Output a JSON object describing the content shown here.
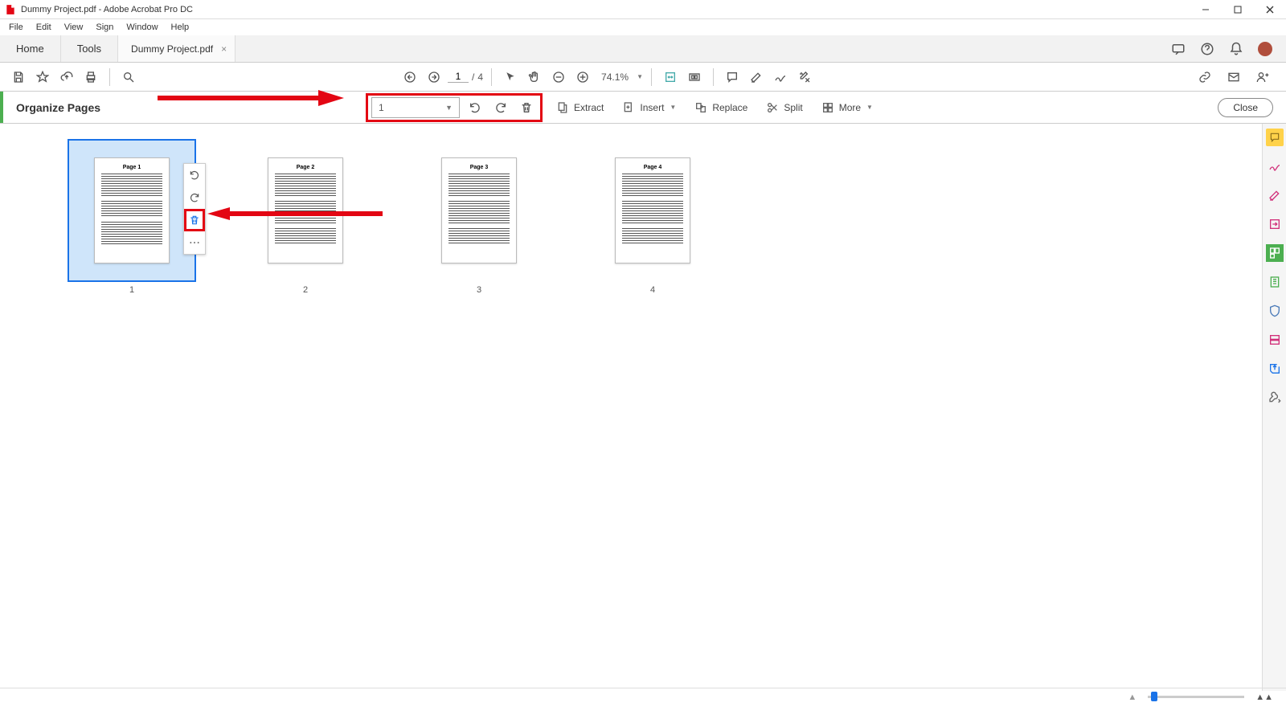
{
  "window": {
    "title": "Dummy Project.pdf - Adobe Acrobat Pro DC"
  },
  "menu": {
    "file": "File",
    "edit": "Edit",
    "view": "View",
    "sign": "Sign",
    "window": "Window",
    "help": "Help"
  },
  "tabs": {
    "home": "Home",
    "tools": "Tools",
    "doc": "Dummy Project.pdf"
  },
  "toolbar": {
    "page_current": "1",
    "page_sep": "/",
    "page_total": "4",
    "zoom": "74.1%"
  },
  "organize": {
    "title": "Organize Pages",
    "page_select_value": "1",
    "extract": "Extract",
    "insert": "Insert",
    "replace": "Replace",
    "split": "Split",
    "more": "More",
    "close": "Close"
  },
  "thumbs": {
    "pages": [
      "1",
      "2",
      "3",
      "4"
    ],
    "headings": [
      "Page 1",
      "Page 2",
      "Page 3",
      "Page 4"
    ]
  }
}
